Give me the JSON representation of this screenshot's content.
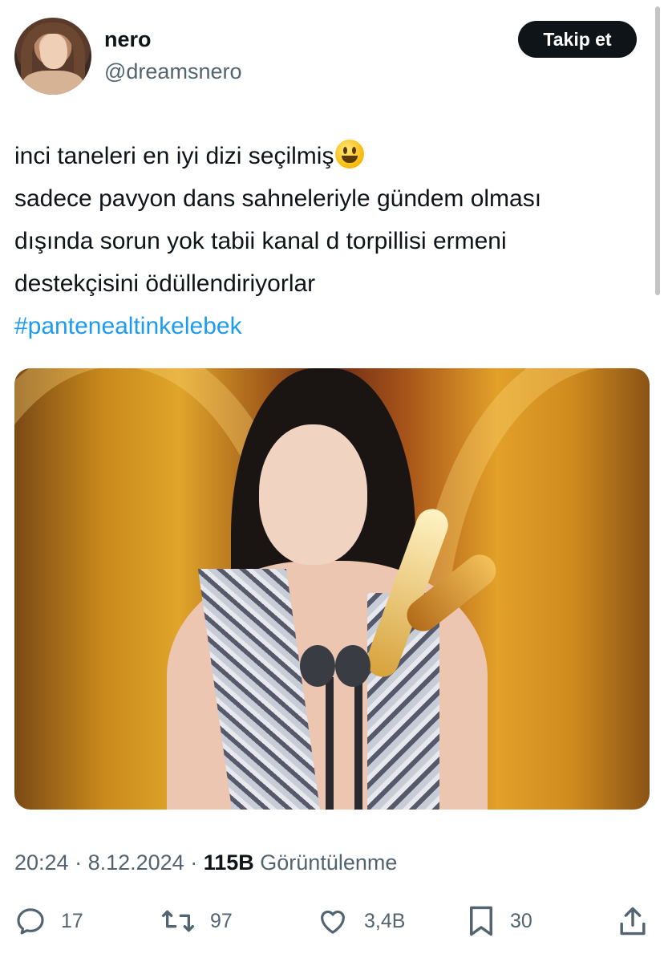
{
  "user": {
    "display_name": "nero",
    "handle": "@dreamsnero",
    "follow_label": "Takip et"
  },
  "tweet": {
    "lines": [
      "inci taneleri en iyi dizi seçilmiş",
      "sadece pavyon dans sahneleriyle gündem olması",
      "dışında sorun yok tabii kanal d torpillisi ermeni",
      "destekçisini ödüllendiriyorlar"
    ],
    "emoji": "smiling-face-emoji",
    "hashtag": "#pantenealtinkelebek"
  },
  "meta": {
    "time": "20:24",
    "separator": " · ",
    "date": "8.12.2024",
    "views_count": "115B",
    "views_label": "Görüntülenme"
  },
  "actions": {
    "replies": {
      "icon": "reply-icon",
      "count": "17"
    },
    "retweets": {
      "icon": "retweet-icon",
      "count": "97"
    },
    "likes": {
      "icon": "heart-icon",
      "count": "3,4B"
    },
    "bookmarks": {
      "icon": "bookmark-icon",
      "count": "30"
    },
    "share": {
      "icon": "share-icon"
    }
  },
  "colors": {
    "text": "#0f1419",
    "secondary": "#536471",
    "link": "#1d9bf0",
    "button_bg": "#0f1419"
  }
}
